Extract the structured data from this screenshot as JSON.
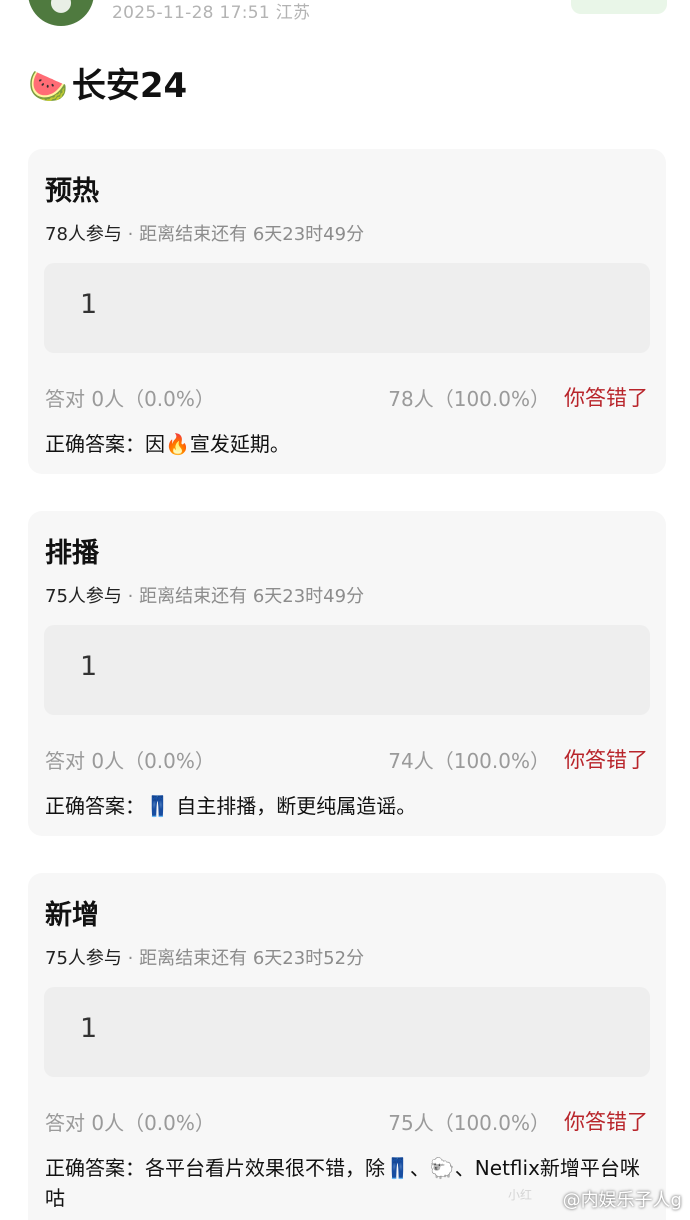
{
  "header": {
    "timestamp": "2025-11-28 17:51",
    "location": "江苏"
  },
  "title": {
    "icon": "watermelon-emoji",
    "icon_glyph": "🍉",
    "text": "长安24"
  },
  "polls": [
    {
      "title": "预热",
      "participants": "78人参与",
      "separator": "·",
      "deadline": "距离结束还有 6天23时49分",
      "option": "1",
      "correct_count": "答对  0人（0.0%）",
      "wrong_count": "78人（100.0%）",
      "result_label": "你答错了",
      "answer_prefix": "正确答案：",
      "answer_text": "因🔥宣发延期。"
    },
    {
      "title": "排播",
      "participants": "75人参与",
      "separator": "·",
      "deadline": "距离结束还有 6天23时49分",
      "option": "1",
      "correct_count": "答对  0人（0.0%）",
      "wrong_count": "74人（100.0%）",
      "result_label": "你答错了",
      "answer_prefix": "正确答案：",
      "answer_text": "👖 自主排播，断更纯属造谣。"
    },
    {
      "title": "新增",
      "participants": "75人参与",
      "separator": "·",
      "deadline": "距离结束还有 6天23时52分",
      "option": "1",
      "correct_count": "答对  0人（0.0%）",
      "wrong_count": "75人（100.0%）",
      "result_label": "你答错了",
      "answer_prefix": "正确答案：",
      "answer_text": "各平台看片效果很不错，除👖、🐑、Netflix新增平台咪咕"
    }
  ],
  "watermark": {
    "text": "@内娱乐子人g",
    "faint_text": "小红"
  },
  "colors": {
    "card_bg": "#f7f7f7",
    "answer_box_bg": "#eeeeee",
    "wrong_red": "#b8242a",
    "muted_gray": "#9a9a9a"
  }
}
